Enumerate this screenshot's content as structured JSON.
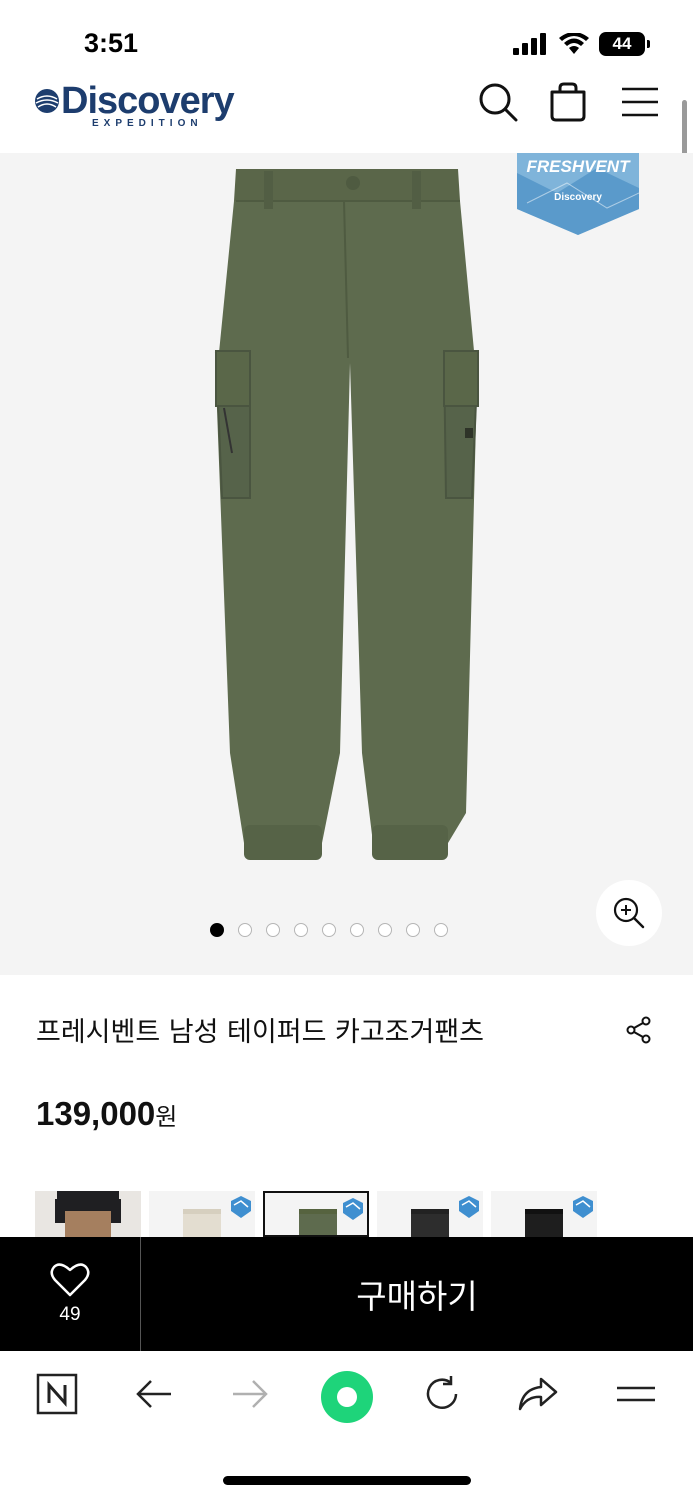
{
  "status_bar": {
    "time": "3:51",
    "battery": "44"
  },
  "header": {
    "brand": "Discovery",
    "brand_sub": "EXPEDITION",
    "icons": [
      "search-icon",
      "shopping-bag-icon",
      "menu-icon"
    ]
  },
  "product_image": {
    "badge_title": "FRESHVENT",
    "badge_brand": "Discovery",
    "pants_color": "#5e6b4e",
    "dots_total": 9,
    "dots_active": 1
  },
  "product": {
    "name": "프레시벤트 남성 테이퍼드 카고조거팬츠",
    "price": "139,000",
    "price_unit": "원"
  },
  "color_options": [
    {
      "color": "#b08a6a",
      "badge": false,
      "selected": false
    },
    {
      "color": "#e8e2d6",
      "badge": true,
      "selected": false
    },
    {
      "color": "#5e6b4e",
      "badge": true,
      "selected": true
    },
    {
      "color": "#2d2d2d",
      "badge": true,
      "selected": false
    },
    {
      "color": "#1e1e1e",
      "badge": true,
      "selected": false
    }
  ],
  "buy_bar": {
    "like_count": "49",
    "buy_label": "구매하기"
  },
  "browser_toolbar": {
    "icons": [
      "naver-icon",
      "back-icon",
      "forward-icon",
      "home-icon",
      "refresh-icon",
      "share-icon",
      "menu-icon"
    ],
    "accent": "#1ed47a"
  }
}
